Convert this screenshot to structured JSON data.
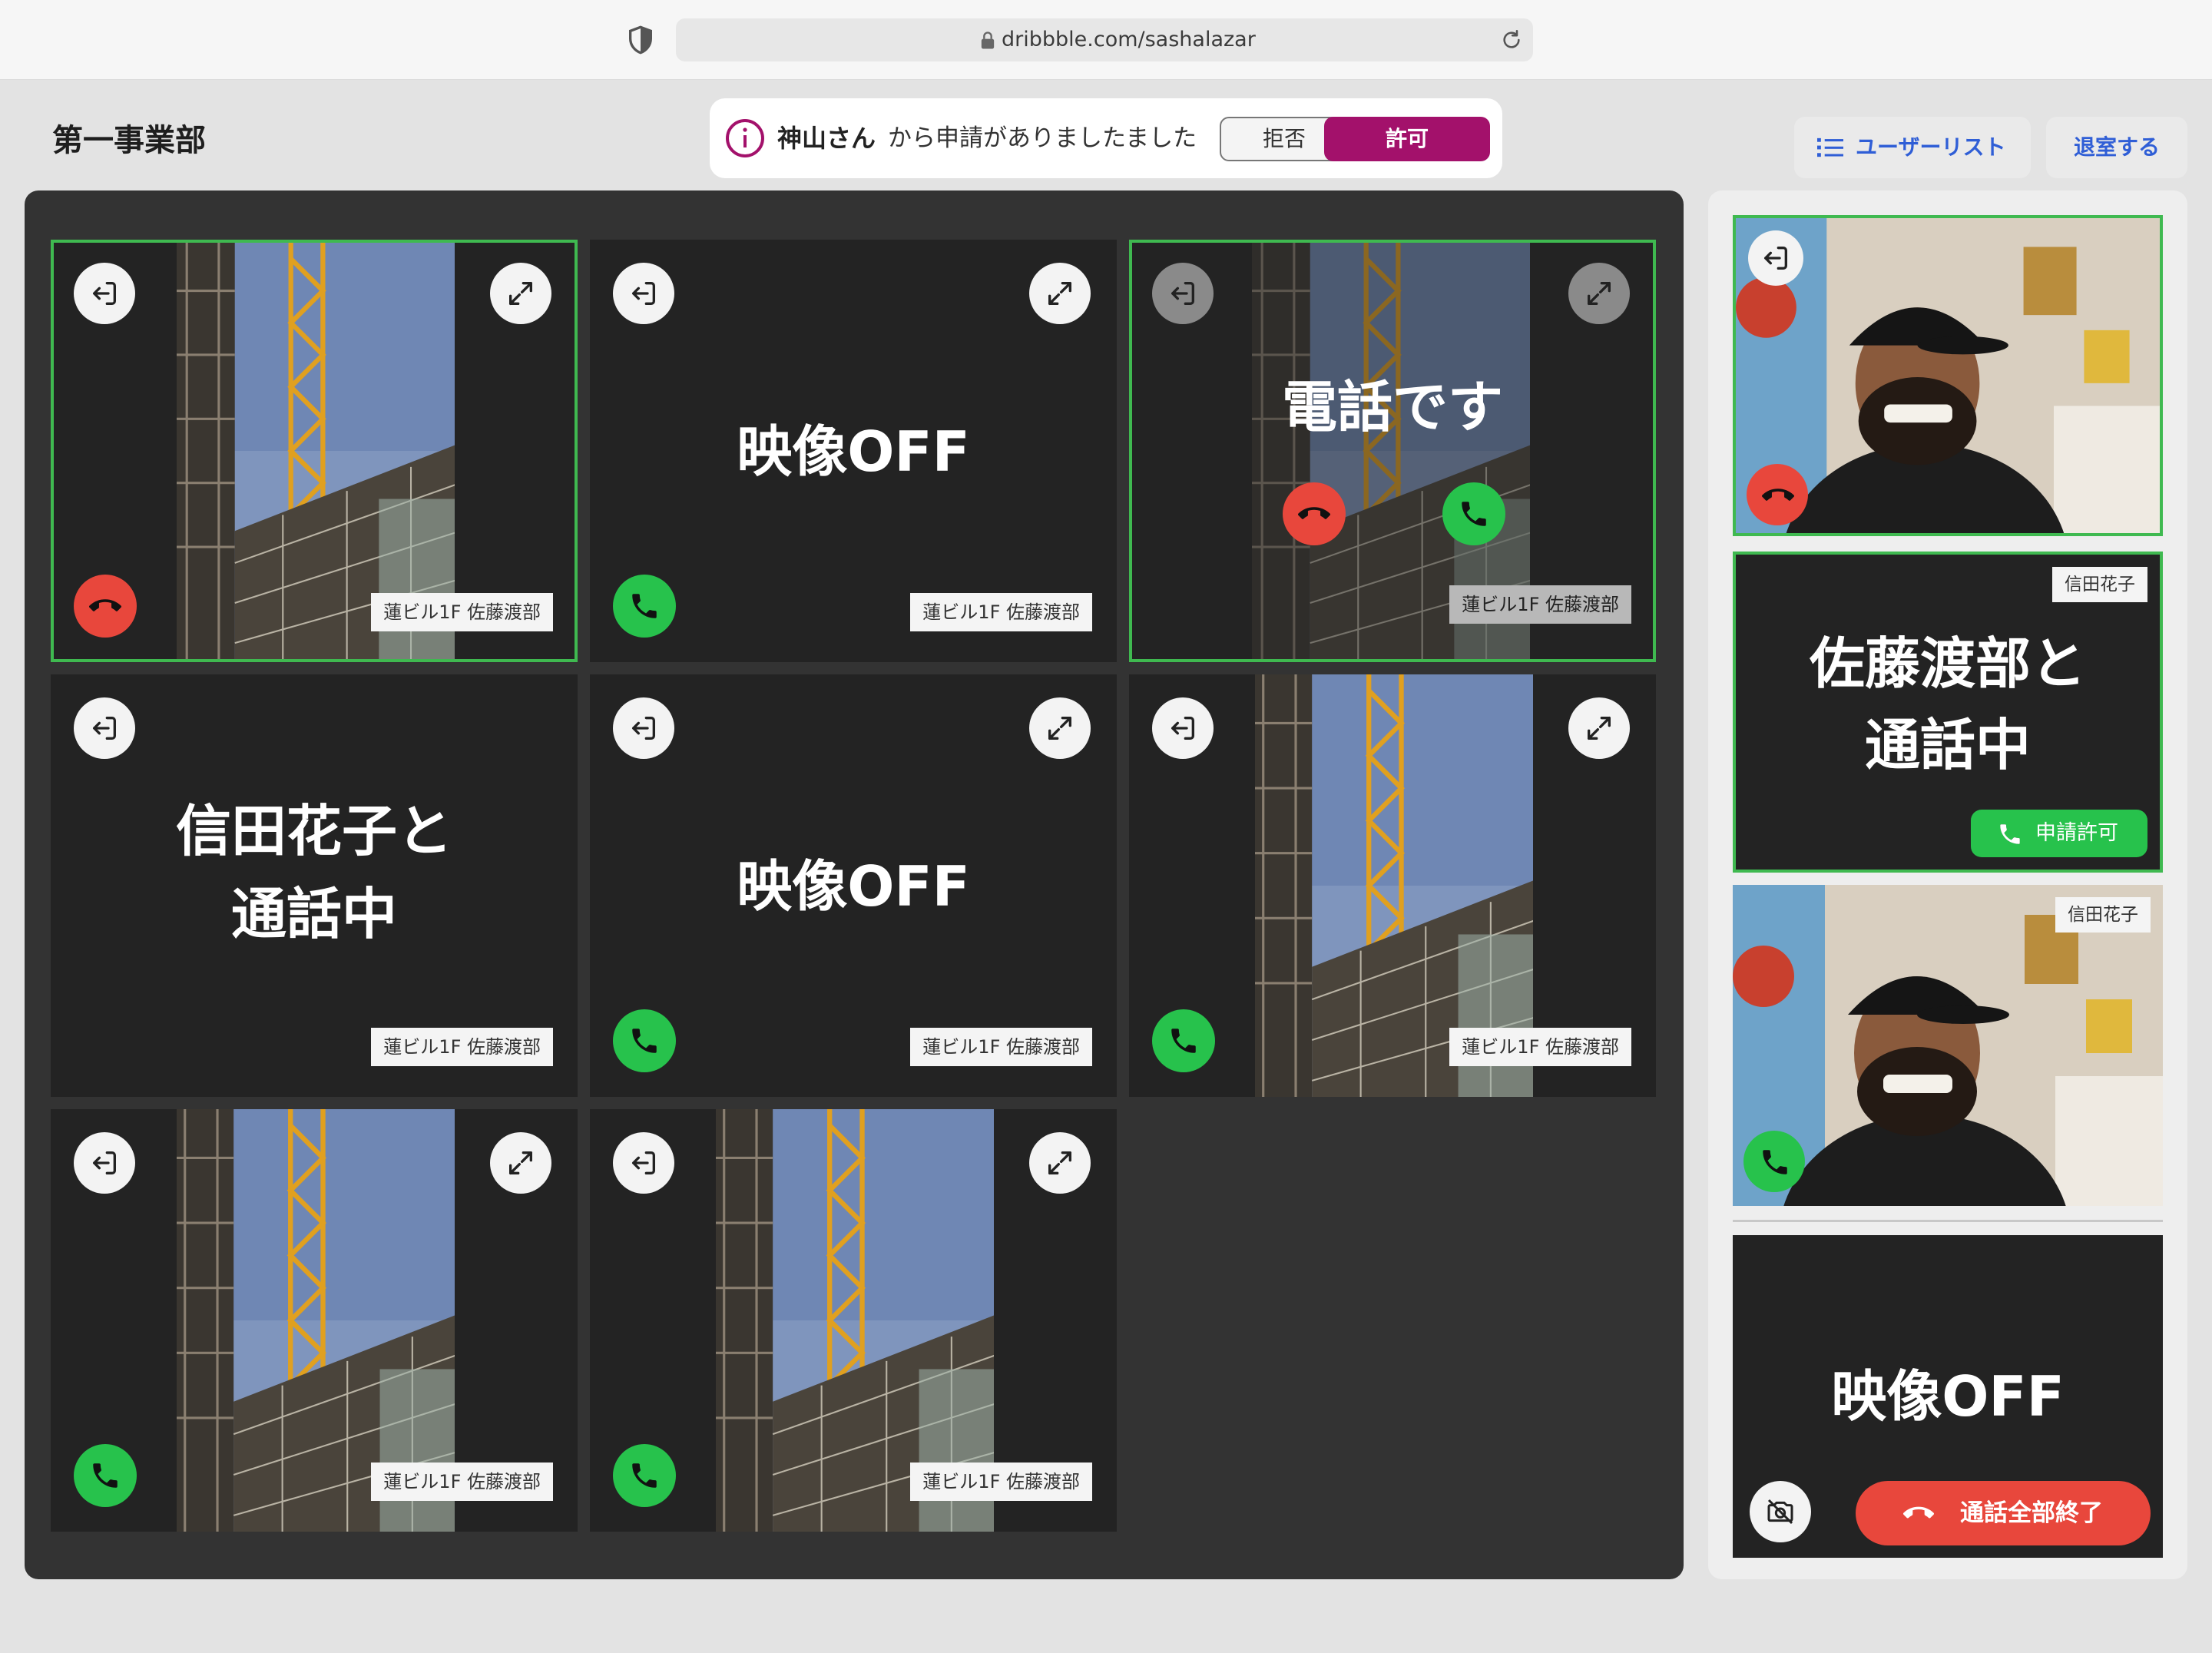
{
  "browser": {
    "url": "dribbble.com/sashalazar"
  },
  "header": {
    "title": "第一事業部",
    "notice": {
      "requester": "神山さん",
      "message": "から申請がありましたました",
      "reject_label": "拒否",
      "allow_label": "許可"
    },
    "user_list_label": "ユーザーリスト",
    "leave_label": "退室する"
  },
  "grid": {
    "tiles": [
      {
        "state": "video",
        "location": "蓮ビル1F 佐藤渡部",
        "call": "red",
        "active": true
      },
      {
        "state": "video_off",
        "status": "映像OFF",
        "location": "蓮ビル1F 佐藤渡部",
        "call": "green"
      },
      {
        "state": "incoming",
        "status": "電話です",
        "location": "蓮ビル1F 佐藤渡部",
        "active": true
      },
      {
        "state": "talking",
        "status_line1": "信田花子と",
        "status_line2": "通話中",
        "location": "蓮ビル1F 佐藤渡部"
      },
      {
        "state": "video_off",
        "status": "映像OFF",
        "location": "蓮ビル1F 佐藤渡部",
        "call": "green"
      },
      {
        "state": "video",
        "location": "蓮ビル1F 佐藤渡部",
        "call": "green"
      },
      {
        "state": "video",
        "location": "蓮ビル1F 佐藤渡部",
        "call": "green"
      },
      {
        "state": "video",
        "location": "蓮ビル1F 佐藤渡部",
        "call": "green"
      }
    ]
  },
  "side": {
    "tiles": [
      {
        "state": "video",
        "call": "red",
        "active": true
      },
      {
        "state": "talking",
        "name": "信田花子",
        "status_line1": "佐藤渡部と",
        "status_line2": "通話中",
        "action_label": "申請許可",
        "active": true
      },
      {
        "state": "video",
        "name": "信田花子",
        "call": "green"
      },
      {
        "state": "video_off",
        "status": "映像OFF",
        "end_all_label": "通話全部終了"
      }
    ]
  },
  "colors": {
    "accent": "#a3116b",
    "active_border": "#3fb950",
    "call_green": "#27c24c",
    "call_red": "#e8473c",
    "link_blue": "#2f5ed6"
  }
}
